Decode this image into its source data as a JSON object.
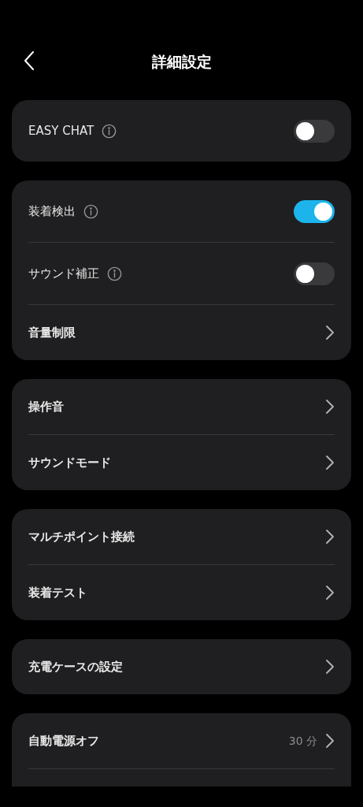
{
  "header": {
    "title": "詳細設定"
  },
  "groups": [
    {
      "items": [
        {
          "kind": "toggle",
          "label": "EASY CHAT",
          "info": true,
          "on": false
        }
      ]
    },
    {
      "items": [
        {
          "kind": "toggle",
          "label": "装着検出",
          "info": true,
          "on": true
        },
        {
          "kind": "toggle",
          "label": "サウンド補正",
          "info": true,
          "on": false
        },
        {
          "kind": "link",
          "label": "音量制限"
        }
      ]
    },
    {
      "items": [
        {
          "kind": "link",
          "label": "操作音"
        },
        {
          "kind": "link",
          "label": "サウンドモード"
        }
      ]
    },
    {
      "items": [
        {
          "kind": "link",
          "label": "マルチポイント接続"
        },
        {
          "kind": "link",
          "label": "装着テスト"
        }
      ]
    },
    {
      "items": [
        {
          "kind": "link",
          "label": "充電ケースの設定"
        }
      ]
    },
    {
      "items": [
        {
          "kind": "link",
          "label": "自動電源オフ",
          "value": "30 分"
        }
      ],
      "cut_off": true
    }
  ]
}
